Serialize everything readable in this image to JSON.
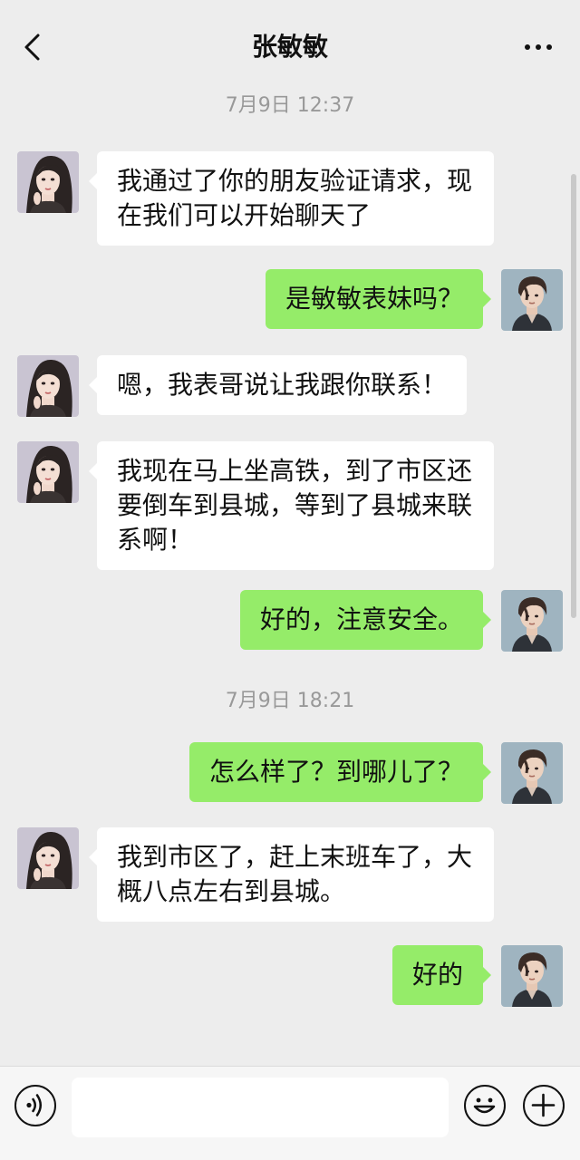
{
  "header": {
    "title": "张敏敏",
    "back_icon": "chevron-left-icon",
    "more_icon": "more-dots-icon"
  },
  "chat": {
    "timestamps": [
      "7月9日 12:37",
      "7月9日 18:21"
    ],
    "messages": [
      {
        "side": "in",
        "sender": "female-avatar",
        "text": "我通过了你的朋友验证请求，现在我们可以开始聊天了"
      },
      {
        "side": "out",
        "sender": "male-avatar",
        "text": "是敏敏表妹吗？"
      },
      {
        "side": "in",
        "sender": "female-avatar",
        "text": "嗯，我表哥说让我跟你联系！"
      },
      {
        "side": "in",
        "sender": "female-avatar",
        "text": "我现在马上坐高铁，到了市区还要倒车到县城，等到了县城来联系啊！"
      },
      {
        "side": "out",
        "sender": "male-avatar",
        "text": "好的，注意安全。"
      },
      {
        "side": "out",
        "sender": "male-avatar",
        "text": "怎么样了？到哪儿了？"
      },
      {
        "side": "in",
        "sender": "female-avatar",
        "text": "我到市区了，赶上末班车了，大概八点左右到县城。"
      },
      {
        "side": "out",
        "sender": "male-avatar",
        "text": "好的"
      }
    ]
  },
  "footer": {
    "voice_icon": "voice-icon",
    "input_value": "",
    "emoji_icon": "emoji-icon",
    "plus_icon": "plus-icon"
  },
  "colors": {
    "background": "#ededed",
    "incoming_bubble": "#ffffff",
    "outgoing_bubble": "#95ec69",
    "timestamp_text": "#999999"
  }
}
